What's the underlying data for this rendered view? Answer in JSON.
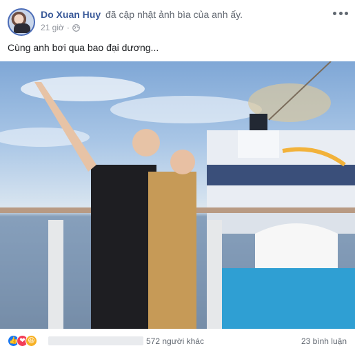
{
  "post": {
    "author": "Do Xuan Huy",
    "action": "đã cập nhật ảnh bìa của anh ấy.",
    "time": "21 giờ",
    "dot": "·",
    "privacy_icon": "globe-icon",
    "more_icon": "more-options-icon",
    "caption": "Cùng anh bơi qua bao đại dương..."
  },
  "photo": {
    "description_icon": "cover-photo"
  },
  "footer": {
    "reactions": [
      "like-icon",
      "love-icon",
      "haha-icon"
    ],
    "others": "572 người khác",
    "comments": "23 bình luận"
  },
  "colors": {
    "author": "#385898",
    "meta": "#90949c",
    "like": "#1877f2",
    "love": "#f33e58",
    "haha": "#f7b125"
  }
}
